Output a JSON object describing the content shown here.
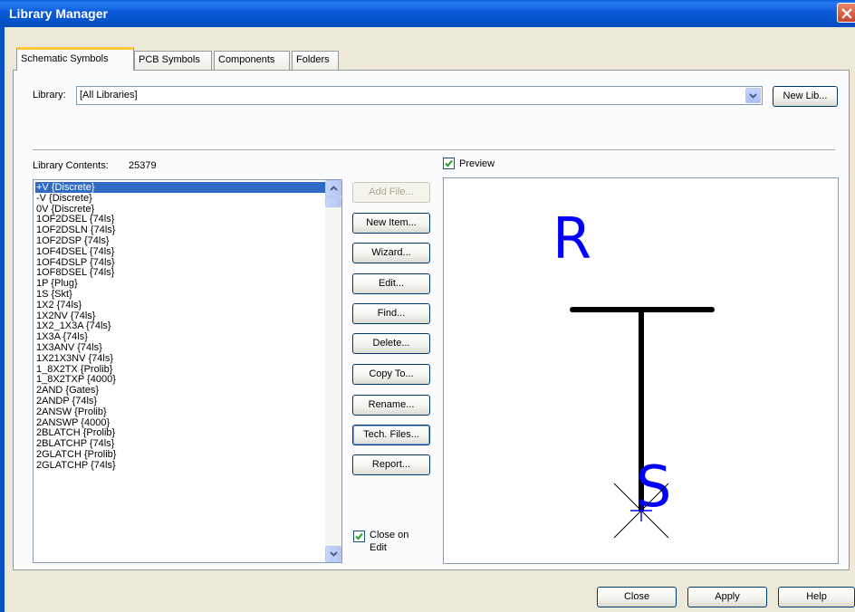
{
  "window": {
    "title": "Library Manager"
  },
  "tabs": [
    {
      "label": "Schematic Symbols",
      "active": true
    },
    {
      "label": "PCB Symbols",
      "active": false
    },
    {
      "label": "Components",
      "active": false
    },
    {
      "label": "Folders",
      "active": false
    }
  ],
  "library": {
    "label": "Library:",
    "selected": "[All Libraries]",
    "new_lib_button": "New Lib..."
  },
  "contents": {
    "label": "Library Contents:",
    "count": "25379",
    "items": [
      "+V {Discrete}",
      "-V {Discrete}",
      "0V {Discrete}",
      "1OF2DSEL {74ls}",
      "1OF2DSLN {74ls}",
      "1OF2DSP {74ls}",
      "1OF4DSEL {74ls}",
      "1OF4DSLP {74ls}",
      "1OF8DSEL {74ls}",
      "1P {Plug}",
      "1S {Skt}",
      "1X2 {74ls}",
      "1X2NV {74ls}",
      "1X2_1X3A {74ls}",
      "1X3A {74ls}",
      "1X3ANV {74ls}",
      "1X21X3NV {74ls}",
      "1_8X2TX {Prolib}",
      "1_8X2TXP {4000}",
      "2AND {Gates}",
      "2ANDP {74ls}",
      "2ANSW {Prolib}",
      "2ANSWP {4000}",
      "2BLATCH {Prolib}",
      "2BLATCHP {74ls}",
      "2GLATCH {Prolib}",
      "2GLATCHP {74ls}"
    ],
    "selected_index": 0
  },
  "actions": {
    "add_file": "Add File...",
    "new_item": "New Item...",
    "wizard": "Wizard...",
    "edit": "Edit...",
    "find": "Find...",
    "delete": "Delete...",
    "copy_to": "Copy To...",
    "rename": "Rename...",
    "tech_files": "Tech. Files...",
    "report": "Report..."
  },
  "close_on_edit": {
    "label_line1": "Close on",
    "label_line2": "Edit",
    "checked": true
  },
  "preview": {
    "label": "Preview",
    "checked": true,
    "symbol_ref": "R",
    "symbol_pin": "S",
    "ref_color": "#0000ff",
    "body_color": "#000000"
  },
  "footer": {
    "close": "Close",
    "apply": "Apply",
    "help": "Help"
  }
}
